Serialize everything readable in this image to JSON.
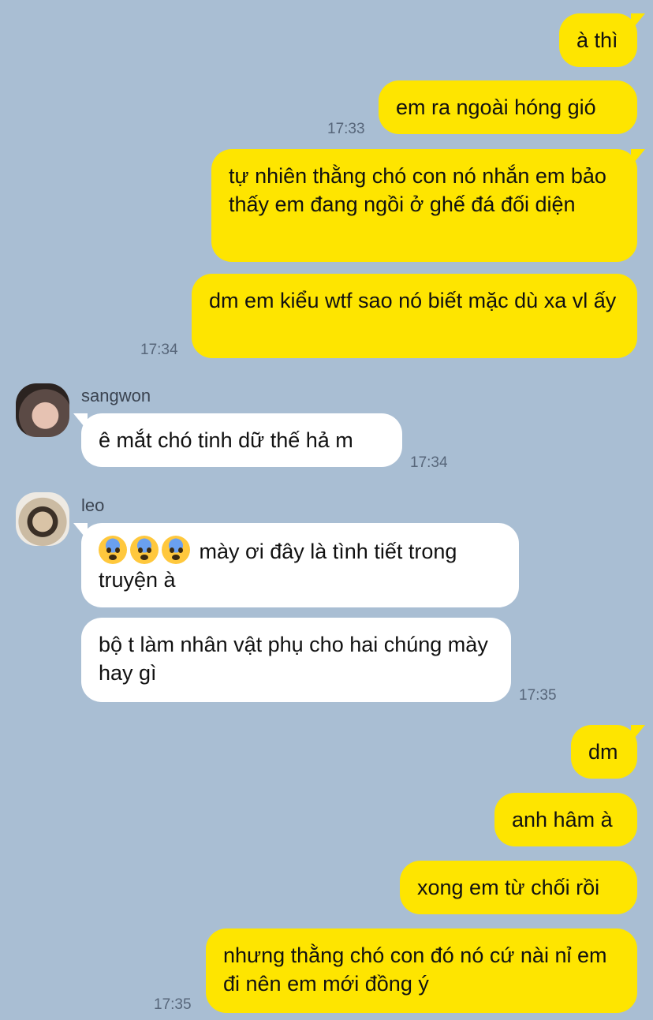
{
  "colors": {
    "background": "#a9bed3",
    "outgoing": "#fee500",
    "incoming": "#ffffff"
  },
  "messages": {
    "m1": "à thì",
    "m2": "em ra ngoài hóng gió",
    "m3": "tự nhiên thằng chó con nó nhắn em bảo thấy em đang ngồi ở ghế đá đối diện",
    "m4": "dm em kiểu wtf sao nó biết mặc dù xa vl ấy",
    "m5": "ê mắt chó tinh dữ thế hả m",
    "m6": "mày ơi đây là tình tiết trong truyện à",
    "m7": "bộ t làm nhân vật phụ cho hai chúng mày hay gì",
    "m8": "dm",
    "m9": "anh hâm à",
    "m10": "xong em từ chối rồi",
    "m11": "nhưng thằng chó con đó nó cứ nài nỉ em đi nên em mới đồng ý"
  },
  "times": {
    "t1": "17:33",
    "t2": "17:34",
    "t3": "17:34",
    "t4": "17:35",
    "t5": "17:35"
  },
  "senders": {
    "s1": "sangwon",
    "s2": "leo"
  },
  "icons": {
    "emoji": "anxious-face-emoji"
  }
}
